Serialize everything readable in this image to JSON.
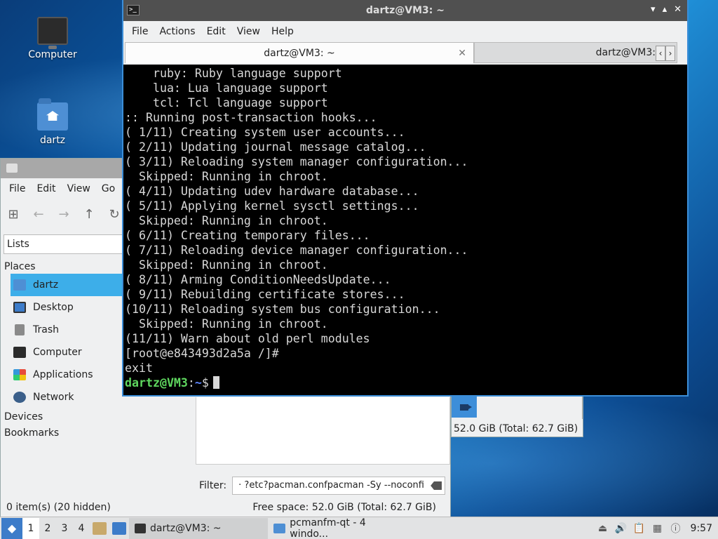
{
  "desktop": {
    "icons": [
      {
        "label": "Computer"
      },
      {
        "label": "dartz"
      }
    ]
  },
  "file_manager": {
    "menu": [
      "File",
      "Edit",
      "View",
      "Go"
    ],
    "side_pane_mode": "Lists",
    "places_heading": "Places",
    "places": [
      {
        "label": "dartz",
        "icon": "home-folder-icon",
        "selected": true
      },
      {
        "label": "Desktop",
        "icon": "desktop-icon"
      },
      {
        "label": "Trash",
        "icon": "trash-icon"
      },
      {
        "label": "Computer",
        "icon": "computer-icon"
      },
      {
        "label": "Applications",
        "icon": "applications-icon"
      },
      {
        "label": "Network",
        "icon": "network-icon"
      }
    ],
    "devices_heading": "Devices",
    "bookmarks_heading": "Bookmarks",
    "filter_label": "Filter:",
    "filter_value": "· ?etc?pacman.confpacman -Sy --noconfi",
    "status_left": "0 item(s) (20 hidden)",
    "status_right": "Free space: 52.0 GiB (Total: 62.7 GiB)"
  },
  "second_window": {
    "status": "52.0 GiB (Total: 62.7 GiB)"
  },
  "terminal": {
    "title": "dartz@VM3: ~",
    "wm_buttons": [
      "▾",
      "▴",
      "✕"
    ],
    "menu": [
      "File",
      "Actions",
      "Edit",
      "View",
      "Help"
    ],
    "tabs": [
      {
        "label": "dartz@VM3: ~",
        "active": true
      },
      {
        "label": "dartz@VM3:",
        "active": false
      }
    ],
    "lines": [
      "    ruby: Ruby language support",
      "    lua: Lua language support",
      "    tcl: Tcl language support",
      ":: Running post-transaction hooks...",
      "( 1/11) Creating system user accounts...",
      "( 2/11) Updating journal message catalog...",
      "( 3/11) Reloading system manager configuration...",
      "  Skipped: Running in chroot.",
      "( 4/11) Updating udev hardware database...",
      "( 5/11) Applying kernel sysctl settings...",
      "  Skipped: Running in chroot.",
      "( 6/11) Creating temporary files...",
      "( 7/11) Reloading device manager configuration...",
      "  Skipped: Running in chroot.",
      "( 8/11) Arming ConditionNeedsUpdate...",
      "( 9/11) Rebuilding certificate stores...",
      "(10/11) Reloading system bus configuration...",
      "  Skipped: Running in chroot.",
      "(11/11) Warn about old perl modules",
      "[root@e843493d2a5a /]#",
      "exit"
    ],
    "prompt_user": "dartz@VM3",
    "prompt_sep": ":",
    "prompt_path": "~",
    "prompt_symbol": "$"
  },
  "taskbar": {
    "desktops": [
      "1",
      "2",
      "3",
      "4"
    ],
    "tasks": [
      {
        "label": "dartz@VM3: ~",
        "active": true
      },
      {
        "label": "pcmanfm-qt - 4 windo...",
        "active": false
      }
    ],
    "clock": "9:57"
  },
  "colors": {
    "accent": "#3daee9",
    "terminal_prompt_user": "#5fd75f",
    "terminal_prompt_path": "#5f87ff"
  }
}
